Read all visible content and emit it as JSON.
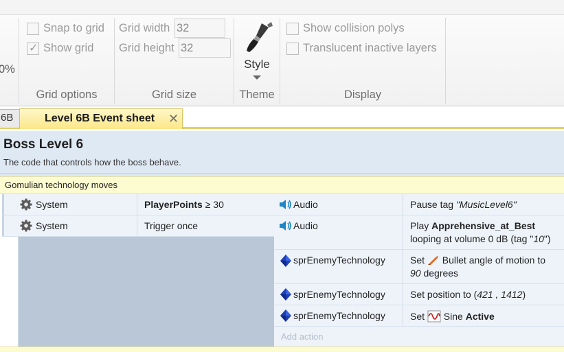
{
  "ribbon": {
    "zoom_fragment": "0%",
    "grid_options": {
      "snap_to_grid": "Snap to grid",
      "show_grid": "Show grid",
      "label": "Grid options"
    },
    "grid_size": {
      "width_label": "Grid width",
      "width_value": "32",
      "height_label": "Grid height",
      "height_value": "32",
      "label": "Grid size"
    },
    "theme": {
      "style_label": "Style",
      "label": "Theme"
    },
    "display": {
      "show_collision": "Show collision polys",
      "translucent": "Translucent inactive layers",
      "label": "Display"
    }
  },
  "tabs": {
    "prev_tab": "6B",
    "active_tab": "Level 6B Event sheet",
    "close_glyph": "✕"
  },
  "group": {
    "title": "Boss Level 6",
    "description": "The code that controls how the boss behave."
  },
  "comment": "Gomulian technology moves",
  "conditions": [
    {
      "object": "System",
      "bold": "PlayerPoints",
      "rest": " ≥ 30"
    },
    {
      "object": "System",
      "bold": "",
      "rest": "Trigger once"
    }
  ],
  "actions": [
    {
      "object": "Audio",
      "l1a": "Pause tag ",
      "l1i": "\"MusicLevel6\"",
      "l1c": ""
    },
    {
      "object": "Audio",
      "l1a": "Play ",
      "l1b": "Apprehensive_at_Best",
      "l2a": "looping at volume 0 dB (tag \"",
      "l2i": "10",
      "l2c": "\")"
    },
    {
      "object": "sprEnemyTechnology",
      "l1a": "Set ",
      "l1c": " Bullet angle of motion to",
      "l2i": "90",
      "l2c": " degrees"
    },
    {
      "object": "sprEnemyTechnology",
      "l1a": "Set position to (",
      "l1i": "421 , 1412",
      "l1c": ")"
    },
    {
      "object": "sprEnemyTechnology",
      "l1a": "Set ",
      "l1c": " Sine ",
      "l1b": "Active"
    }
  ],
  "add_action": "Add action",
  "colors": {
    "tab_active": "#fbe789",
    "sheet_bg": "#dce8f3",
    "comment_bg": "#fdfbd0",
    "condition_area": "#b9c7d7"
  }
}
